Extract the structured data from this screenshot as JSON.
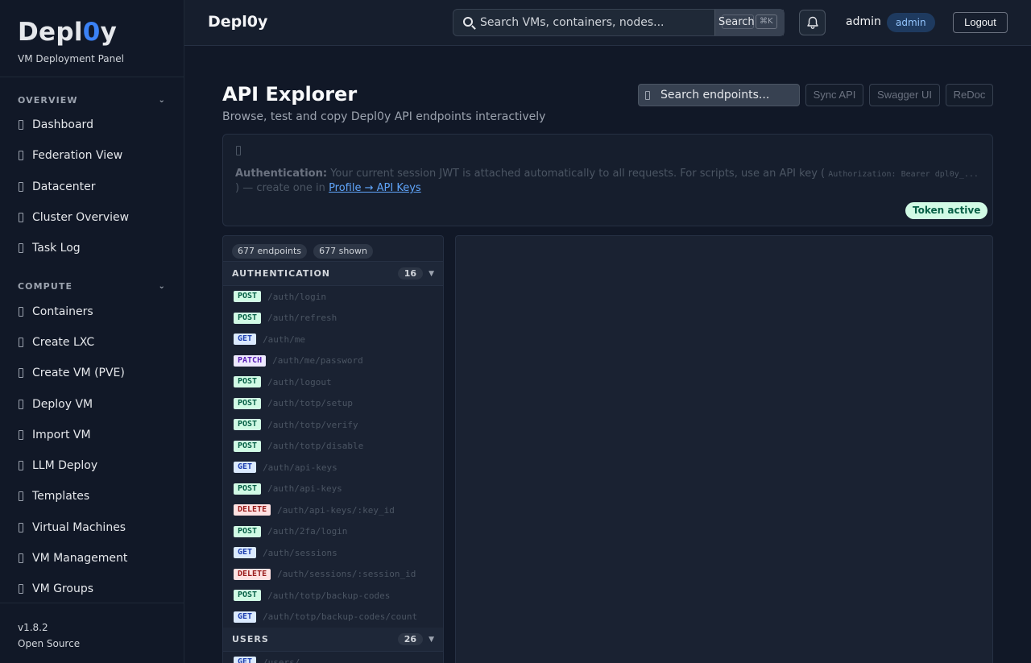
{
  "sidebar": {
    "brand_prefix": "Depl",
    "brand_zero": "0",
    "brand_suffix": "y",
    "subtitle": "VM Deployment Panel",
    "sections": [
      {
        "title": "OVERVIEW",
        "items": [
          "Dashboard",
          "Federation View",
          "Datacenter",
          "Cluster Overview",
          "Task Log"
        ]
      },
      {
        "title": "COMPUTE",
        "items": [
          "Containers",
          "Create LXC",
          "Create VM (PVE)",
          "Deploy VM",
          "Import VM",
          "LLM Deploy",
          "Templates",
          "Virtual Machines",
          "VM Management",
          "VM Groups"
        ]
      }
    ],
    "version": "v1.8.2",
    "license": "Open Source"
  },
  "topbar": {
    "title": "Depl0y",
    "search_placeholder": "Search VMs, containers, nodes...",
    "search_button": "Search",
    "shortcut_key": "⌘K",
    "user": "admin",
    "role": "admin",
    "logout": "Logout"
  },
  "page": {
    "title": "API Explorer",
    "subtitle": "Browse, test and copy Depl0y API endpoints interactively",
    "endpoint_search_placeholder": "Search endpoints...",
    "buttons": {
      "sync": "Sync API",
      "swagger": "Swagger UI",
      "redoc": "ReDoc"
    }
  },
  "auth_notice": {
    "label": "Authentication:",
    "text_before": "Your current session JWT is attached automatically to all requests. For scripts, use an API key (",
    "code": "Authorization: Bearer dpl0y_...",
    "text_after": ") — create one in",
    "link": "Profile → API Keys",
    "token_status": "Token active"
  },
  "endpoints": {
    "total": "677 endpoints",
    "shown": "677 shown",
    "groups": [
      {
        "name": "AUTHENTICATION",
        "count": "16",
        "items": [
          {
            "method": "POST",
            "path": "/auth/login"
          },
          {
            "method": "POST",
            "path": "/auth/refresh"
          },
          {
            "method": "GET",
            "path": "/auth/me"
          },
          {
            "method": "PATCH",
            "path": "/auth/me/password"
          },
          {
            "method": "POST",
            "path": "/auth/logout"
          },
          {
            "method": "POST",
            "path": "/auth/totp/setup"
          },
          {
            "method": "POST",
            "path": "/auth/totp/verify"
          },
          {
            "method": "POST",
            "path": "/auth/totp/disable"
          },
          {
            "method": "GET",
            "path": "/auth/api-keys"
          },
          {
            "method": "POST",
            "path": "/auth/api-keys"
          },
          {
            "method": "DELETE",
            "path": "/auth/api-keys/:key_id"
          },
          {
            "method": "POST",
            "path": "/auth/2fa/login"
          },
          {
            "method": "GET",
            "path": "/auth/sessions"
          },
          {
            "method": "DELETE",
            "path": "/auth/sessions/:session_id"
          },
          {
            "method": "POST",
            "path": "/auth/totp/backup-codes"
          },
          {
            "method": "GET",
            "path": "/auth/totp/backup-codes/count"
          }
        ]
      },
      {
        "name": "USERS",
        "count": "26",
        "items": [
          {
            "method": "GET",
            "path": "/users/"
          }
        ]
      }
    ]
  }
}
